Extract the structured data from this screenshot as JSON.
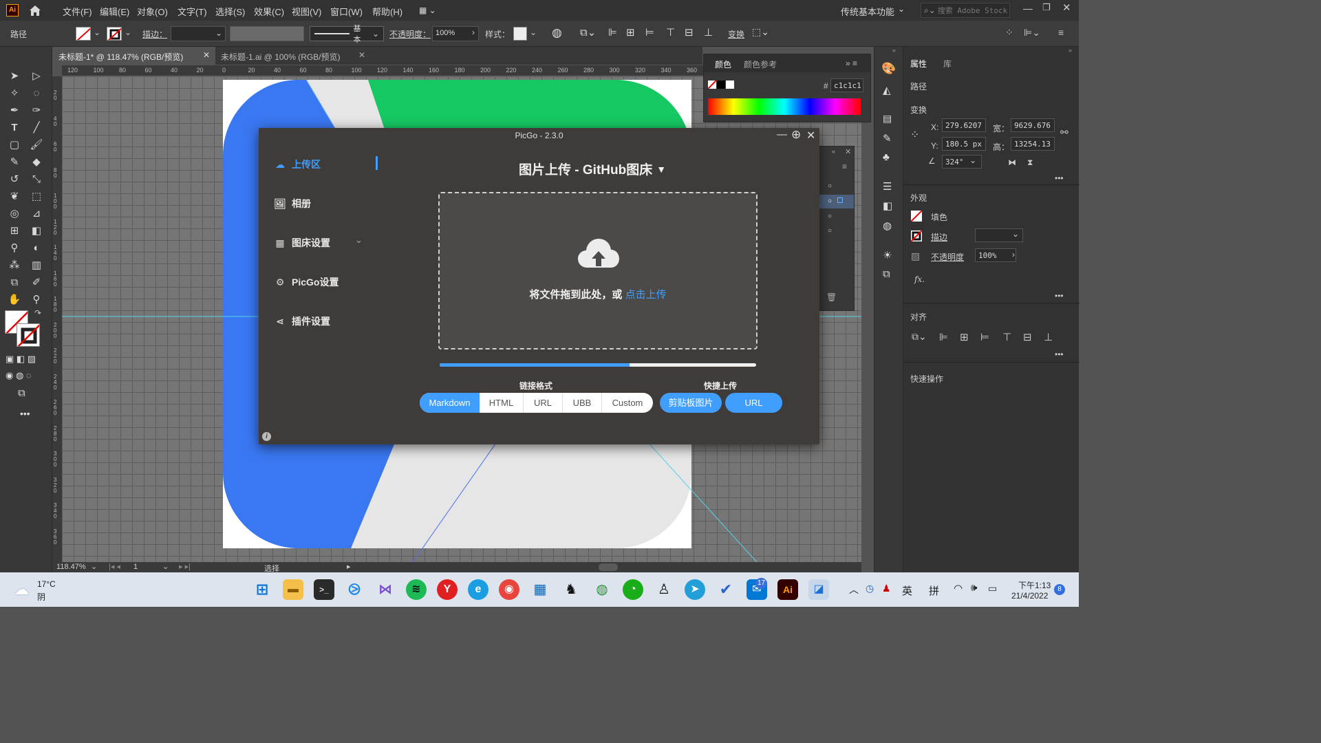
{
  "menubar": {
    "logo": "Ai",
    "items": [
      "文件(F)",
      "编辑(E)",
      "对象(O)",
      "文字(T)",
      "选择(S)",
      "效果(C)",
      "视图(V)",
      "窗口(W)",
      "帮助(H)"
    ],
    "workspace": "传统基本功能",
    "search_placeholder": "搜索 Adobe Stock"
  },
  "toolbar": {
    "object_label": "路径",
    "stroke_label": "描边：",
    "stroke_style": "基本",
    "opacity_label": "不透明度：",
    "opacity_value": "100%",
    "style_label": "样式：",
    "transform_label": "变换"
  },
  "tabs": [
    {
      "label": "未标题-1* @ 118.47% (RGB/预览)",
      "active": true
    },
    {
      "label": "未标题-1.ai @ 100% (RGB/预览)",
      "active": false
    }
  ],
  "ruler_h": [
    "120",
    "100",
    "80",
    "60",
    "40",
    "20",
    "0",
    "20",
    "40",
    "60",
    "80",
    "100",
    "120",
    "140",
    "160",
    "180",
    "200",
    "220",
    "240",
    "260",
    "280",
    "300",
    "320",
    "340",
    "360"
  ],
  "ruler_v": [
    "20",
    "40",
    "60",
    "80",
    "100",
    "120",
    "140",
    "160",
    "180",
    "200",
    "220",
    "240",
    "260",
    "280",
    "300",
    "320",
    "340",
    "360"
  ],
  "color_panel": {
    "tabs": [
      "颜色",
      "颜色参考"
    ],
    "hex_prefix": "#",
    "hex": "c1c1c1"
  },
  "picgo": {
    "title": "PicGo - 2.3.0",
    "nav": [
      {
        "label": "上传区",
        "icon": "cloud-upload-icon",
        "active": true
      },
      {
        "label": "相册",
        "icon": "image-icon",
        "active": false
      },
      {
        "label": "图床设置",
        "icon": "grid-icon",
        "active": false
      },
      {
        "label": "PicGo设置",
        "icon": "gear-icon",
        "active": false
      },
      {
        "label": "插件设置",
        "icon": "share-icon",
        "active": false
      }
    ],
    "heading": "图片上传 - GitHub图床",
    "drop_text": "将文件拖到此处，或",
    "drop_link": "点击上传",
    "progress": 0.6,
    "link_format_label": "链接格式",
    "formats": [
      "Markdown",
      "HTML",
      "URL",
      "UBB",
      "Custom"
    ],
    "selected_format": "Markdown",
    "quick_label": "快捷上传",
    "quick_buttons": [
      "剪贴板图片",
      "URL"
    ],
    "accent": "#409eff"
  },
  "properties": {
    "tabs": [
      "属性",
      "库"
    ],
    "object": "路径",
    "transform_title": "变换",
    "x_label": "X:",
    "x": "279.6207",
    "y_label": "Y:",
    "y": "180.5 px",
    "w_label": "宽：",
    "w": "9629.676",
    "h_label": "高：",
    "h": "13254.13",
    "angle": "324°",
    "appearance_title": "外观",
    "fill_label": "填色",
    "stroke_label": "描边",
    "opacity_label": "不透明度",
    "opacity_value": "100%",
    "fx": "fx.",
    "align_title": "对齐",
    "quick_actions": "快速操作"
  },
  "status": {
    "zoom": "118.47%",
    "page": "1",
    "tool": "选择"
  },
  "taskbar": {
    "temp": "17°C",
    "weather": "阴",
    "ime1": "英",
    "ime2": "拼",
    "time": "下午1:13",
    "date": "21/4/2022",
    "badge": "17",
    "notif": "8"
  }
}
